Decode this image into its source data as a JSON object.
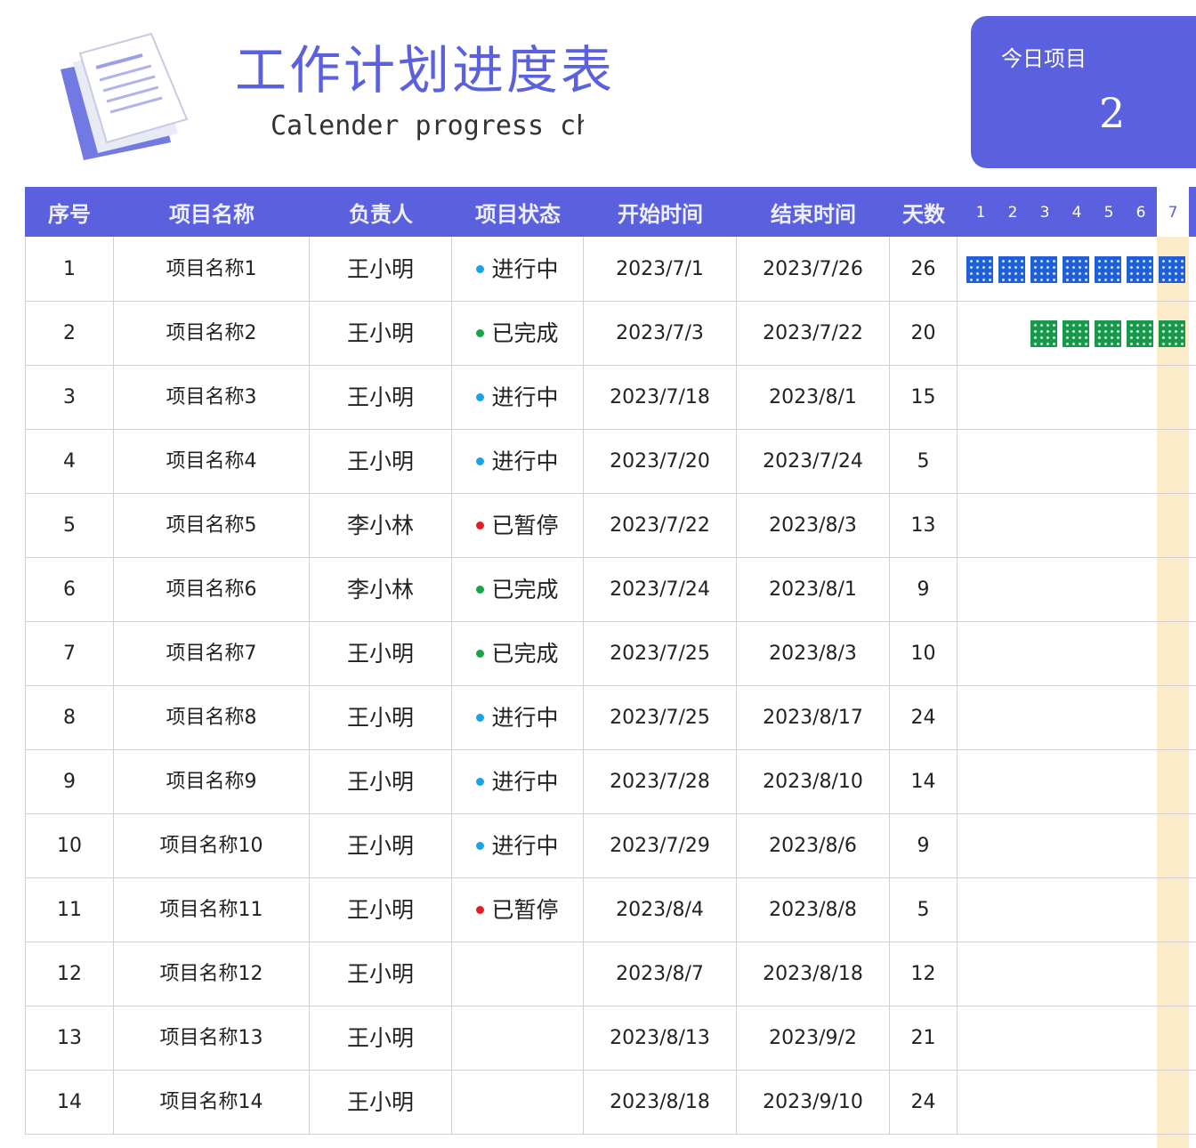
{
  "header": {
    "title": "工作计划进度表",
    "subtitle": "Calender progress chart"
  },
  "today_card": {
    "label": "今日项目",
    "count": "2"
  },
  "colors": {
    "accent": "#5b61de",
    "in_progress": "#1aa3e8",
    "done": "#1aa34a",
    "paused": "#e02020",
    "today_column": "#fcecc9"
  },
  "columns": [
    "序号",
    "项目名称",
    "负责人",
    "项目状态",
    "开始时间",
    "结束时间",
    "天数"
  ],
  "days": [
    "1",
    "2",
    "3",
    "4",
    "5",
    "6",
    "7"
  ],
  "today_day": "7",
  "rows": [
    {
      "no": "1",
      "name": "项目名称1",
      "owner": "王小明",
      "status": "进行中",
      "status_color": "#1aa3e8",
      "start": "2023/7/1",
      "end": "2023/7/26",
      "days": "26"
    },
    {
      "no": "2",
      "name": "项目名称2",
      "owner": "王小明",
      "status": "已完成",
      "status_color": "#1aa34a",
      "start": "2023/7/3",
      "end": "2023/7/22",
      "days": "20"
    },
    {
      "no": "3",
      "name": "项目名称3",
      "owner": "王小明",
      "status": "进行中",
      "status_color": "#1aa3e8",
      "start": "2023/7/18",
      "end": "2023/8/1",
      "days": "15"
    },
    {
      "no": "4",
      "name": "项目名称4",
      "owner": "王小明",
      "status": "进行中",
      "status_color": "#1aa3e8",
      "start": "2023/7/20",
      "end": "2023/7/24",
      "days": "5"
    },
    {
      "no": "5",
      "name": "项目名称5",
      "owner": "李小林",
      "status": "已暂停",
      "status_color": "#e02020",
      "start": "2023/7/22",
      "end": "2023/8/3",
      "days": "13"
    },
    {
      "no": "6",
      "name": "项目名称6",
      "owner": "李小林",
      "status": "已完成",
      "status_color": "#1aa34a",
      "start": "2023/7/24",
      "end": "2023/8/1",
      "days": "9"
    },
    {
      "no": "7",
      "name": "项目名称7",
      "owner": "王小明",
      "status": "已完成",
      "status_color": "#1aa34a",
      "start": "2023/7/25",
      "end": "2023/8/3",
      "days": "10"
    },
    {
      "no": "8",
      "name": "项目名称8",
      "owner": "王小明",
      "status": "进行中",
      "status_color": "#1aa3e8",
      "start": "2023/7/25",
      "end": "2023/8/17",
      "days": "24"
    },
    {
      "no": "9",
      "name": "项目名称9",
      "owner": "王小明",
      "status": "进行中",
      "status_color": "#1aa3e8",
      "start": "2023/7/28",
      "end": "2023/8/10",
      "days": "14"
    },
    {
      "no": "10",
      "name": "项目名称10",
      "owner": "王小明",
      "status": "进行中",
      "status_color": "#1aa3e8",
      "start": "2023/7/29",
      "end": "2023/8/6",
      "days": "9"
    },
    {
      "no": "11",
      "name": "项目名称11",
      "owner": "王小明",
      "status": "已暂停",
      "status_color": "#e02020",
      "start": "2023/8/4",
      "end": "2023/8/8",
      "days": "5"
    },
    {
      "no": "12",
      "name": "项目名称12",
      "owner": "王小明",
      "status": "",
      "status_color": "",
      "start": "2023/8/7",
      "end": "2023/8/18",
      "days": "12"
    },
    {
      "no": "13",
      "name": "项目名称13",
      "owner": "王小明",
      "status": "",
      "status_color": "",
      "start": "2023/8/13",
      "end": "2023/9/2",
      "days": "21"
    },
    {
      "no": "14",
      "name": "项目名称14",
      "owner": "王小明",
      "status": "",
      "status_color": "",
      "start": "2023/8/18",
      "end": "2023/9/10",
      "days": "24"
    }
  ]
}
